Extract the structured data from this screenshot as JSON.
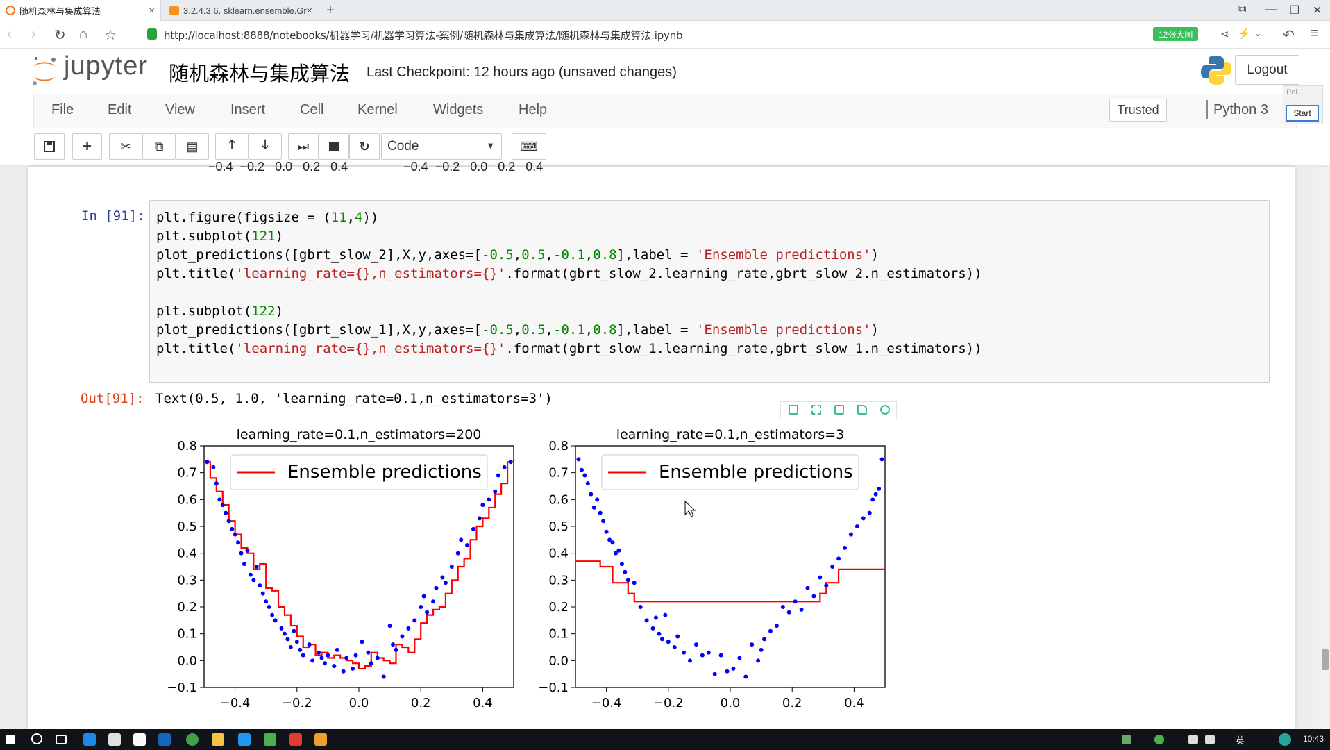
{
  "browser": {
    "tabs": [
      {
        "title": "随机森林与集成算法",
        "active": true
      },
      {
        "title": "3.2.4.3.6. sklearn.ensemble.Gr",
        "active": false
      }
    ],
    "url": "http://localhost:8888/notebooks/机器学习/机器学习算法-案例/随机森林与集成算法/随机森林与集成算法.ipynb",
    "badge": "12张大图"
  },
  "jupyter": {
    "logo_text": "jupyter",
    "notebook_title": "随机森林与集成算法",
    "checkpoint": "Last Checkpoint: 12 hours ago (unsaved changes)",
    "logout_label": "Logout",
    "menu": [
      "File",
      "Edit",
      "View",
      "Insert",
      "Cell",
      "Kernel",
      "Widgets",
      "Help"
    ],
    "trusted_label": "Trusted",
    "kernel_label": "Python 3",
    "popup_label": "Poi...",
    "start_label": "Start",
    "cell_type": "Code"
  },
  "cell": {
    "in_prompt": "In [91]:",
    "out_prompt": "Out[91]:",
    "output_text": "Text(0.5, 1.0, 'learning_rate=0.1,n_estimators=3')",
    "code": [
      "plt.figure(figsize = (11,4))",
      "plt.subplot(121)",
      "plot_predictions([gbrt_slow_2],X,y,axes=[-0.5,0.5,-0.1,0.8],label = 'Ensemble predictions')",
      "plt.title('learning_rate={},n_estimators={}'.format(gbrt_slow_2.learning_rate,gbrt_slow_2.n_estimators))",
      "",
      "plt.subplot(122)",
      "plot_predictions([gbrt_slow_1],X,y,axes=[-0.5,0.5,-0.1,0.8],label = 'Ensemble predictions')",
      "plt.title('learning_rate={},n_estimators={}'.format(gbrt_slow_1.learning_rate,gbrt_slow_1.n_estimators))"
    ]
  },
  "top_axis_remnant": "−0.4  −0.2   0.0   0.2   0.4                −0.4  −0.2   0.0   0.2   0.4",
  "taskbar": {
    "clock": "10:43",
    "lang": "英"
  },
  "colors": {
    "series_line": "#ff0000",
    "series_points": "#0000ff",
    "jupyter_orange": "#f37726"
  },
  "chart_data": [
    {
      "type": "scatter",
      "title": "learning_rate=0.1,n_estimators=200",
      "xlim": [
        -0.5,
        0.5
      ],
      "ylim": [
        -0.1,
        0.8
      ],
      "xticks": [
        "−0.4",
        "−0.2",
        "0.0",
        "0.2",
        "0.4"
      ],
      "yticks": [
        "−0.1",
        "0.0",
        "0.1",
        "0.2",
        "0.3",
        "0.4",
        "0.5",
        "0.6",
        "0.7",
        "0.8"
      ],
      "legend": {
        "label": "Ensemble predictions",
        "position": "upper center"
      },
      "series": [
        {
          "name": "Ensemble predictions",
          "kind": "step-line",
          "x": [
            -0.5,
            -0.48,
            -0.46,
            -0.44,
            -0.42,
            -0.4,
            -0.38,
            -0.36,
            -0.34,
            -0.32,
            -0.3,
            -0.28,
            -0.26,
            -0.24,
            -0.22,
            -0.2,
            -0.18,
            -0.16,
            -0.14,
            -0.12,
            -0.1,
            -0.08,
            -0.06,
            -0.04,
            -0.02,
            0.0,
            0.02,
            0.04,
            0.06,
            0.08,
            0.1,
            0.12,
            0.14,
            0.16,
            0.18,
            0.2,
            0.22,
            0.24,
            0.26,
            0.28,
            0.3,
            0.32,
            0.34,
            0.36,
            0.38,
            0.4,
            0.42,
            0.44,
            0.46,
            0.48,
            0.5
          ],
          "y": [
            0.74,
            0.68,
            0.63,
            0.58,
            0.52,
            0.47,
            0.42,
            0.4,
            0.34,
            0.36,
            0.27,
            0.26,
            0.2,
            0.17,
            0.13,
            0.09,
            0.05,
            0.06,
            0.02,
            0.03,
            0.01,
            0.02,
            0.01,
            0.0,
            -0.01,
            -0.03,
            -0.02,
            0.03,
            0.01,
            0.0,
            -0.01,
            0.06,
            0.05,
            0.03,
            0.08,
            0.14,
            0.17,
            0.19,
            0.2,
            0.25,
            0.3,
            0.35,
            0.38,
            0.45,
            0.5,
            0.53,
            0.57,
            0.62,
            0.66,
            0.74,
            0.75
          ]
        },
        {
          "name": "",
          "kind": "points",
          "x": [
            -0.49,
            -0.47,
            -0.46,
            -0.45,
            -0.44,
            -0.43,
            -0.42,
            -0.41,
            -0.4,
            -0.39,
            -0.38,
            -0.37,
            -0.36,
            -0.35,
            -0.34,
            -0.33,
            -0.32,
            -0.31,
            -0.3,
            -0.29,
            -0.28,
            -0.27,
            -0.25,
            -0.24,
            -0.23,
            -0.22,
            -0.21,
            -0.2,
            -0.19,
            -0.18,
            -0.16,
            -0.15,
            -0.13,
            -0.12,
            -0.11,
            -0.1,
            -0.08,
            -0.07,
            -0.05,
            -0.04,
            -0.02,
            -0.01,
            0.01,
            0.03,
            0.04,
            0.06,
            0.08,
            0.1,
            0.11,
            0.12,
            0.14,
            0.16,
            0.18,
            0.2,
            0.21,
            0.22,
            0.24,
            0.25,
            0.27,
            0.28,
            0.3,
            0.32,
            0.33,
            0.35,
            0.37,
            0.39,
            0.4,
            0.42,
            0.44,
            0.45,
            0.47,
            0.49
          ],
          "y": [
            0.74,
            0.72,
            0.66,
            0.6,
            0.58,
            0.55,
            0.52,
            0.49,
            0.47,
            0.44,
            0.4,
            0.36,
            0.41,
            0.32,
            0.3,
            0.35,
            0.28,
            0.25,
            0.22,
            0.2,
            0.17,
            0.15,
            0.12,
            0.1,
            0.08,
            0.05,
            0.11,
            0.07,
            0.04,
            0.02,
            0.06,
            0.0,
            0.03,
            0.01,
            -0.01,
            0.02,
            -0.02,
            0.04,
            -0.04,
            0.01,
            -0.03,
            0.02,
            0.07,
            0.03,
            -0.01,
            0.01,
            -0.06,
            0.13,
            0.06,
            0.04,
            0.09,
            0.12,
            0.15,
            0.2,
            0.24,
            0.18,
            0.22,
            0.27,
            0.31,
            0.29,
            0.35,
            0.4,
            0.45,
            0.43,
            0.49,
            0.53,
            0.58,
            0.6,
            0.63,
            0.69,
            0.72,
            0.74
          ]
        }
      ]
    },
    {
      "type": "scatter",
      "title": "learning_rate=0.1,n_estimators=3",
      "xlim": [
        -0.5,
        0.5
      ],
      "ylim": [
        -0.1,
        0.8
      ],
      "xticks": [
        "−0.4",
        "−0.2",
        "0.0",
        "0.2",
        "0.4"
      ],
      "yticks": [
        "−0.1",
        "0.0",
        "0.1",
        "0.2",
        "0.3",
        "0.4",
        "0.5",
        "0.6",
        "0.7",
        "0.8"
      ],
      "legend": {
        "label": "Ensemble predictions",
        "position": "upper center"
      },
      "series": [
        {
          "name": "Ensemble predictions",
          "kind": "step-line",
          "x": [
            -0.5,
            -0.42,
            -0.42,
            -0.38,
            -0.38,
            -0.33,
            -0.33,
            -0.31,
            -0.31,
            0.29,
            0.29,
            0.31,
            0.31,
            0.35,
            0.35,
            0.5
          ],
          "y": [
            0.37,
            0.37,
            0.35,
            0.35,
            0.29,
            0.29,
            0.25,
            0.25,
            0.22,
            0.22,
            0.25,
            0.25,
            0.29,
            0.29,
            0.34,
            0.34
          ]
        },
        {
          "name": "",
          "kind": "points",
          "x": [
            -0.49,
            -0.48,
            -0.47,
            -0.46,
            -0.45,
            -0.44,
            -0.43,
            -0.42,
            -0.41,
            -0.4,
            -0.39,
            -0.38,
            -0.37,
            -0.36,
            -0.35,
            -0.34,
            -0.33,
            -0.31,
            -0.29,
            -0.27,
            -0.25,
            -0.24,
            -0.23,
            -0.22,
            -0.21,
            -0.2,
            -0.18,
            -0.17,
            -0.15,
            -0.13,
            -0.11,
            -0.09,
            -0.07,
            -0.05,
            -0.03,
            -0.01,
            0.01,
            0.03,
            0.05,
            0.07,
            0.09,
            0.1,
            0.11,
            0.13,
            0.15,
            0.17,
            0.19,
            0.21,
            0.23,
            0.25,
            0.27,
            0.29,
            0.31,
            0.33,
            0.35,
            0.37,
            0.39,
            0.41,
            0.43,
            0.45,
            0.46,
            0.47,
            0.48,
            0.49
          ],
          "y": [
            0.75,
            0.71,
            0.69,
            0.66,
            0.62,
            0.57,
            0.6,
            0.55,
            0.52,
            0.48,
            0.45,
            0.44,
            0.4,
            0.41,
            0.36,
            0.33,
            0.3,
            0.29,
            0.2,
            0.15,
            0.12,
            0.16,
            0.1,
            0.08,
            0.17,
            0.07,
            0.05,
            0.09,
            0.03,
            0.0,
            0.06,
            0.02,
            0.03,
            -0.05,
            0.02,
            -0.04,
            -0.03,
            0.01,
            -0.06,
            0.06,
            0.0,
            0.04,
            0.08,
            0.11,
            0.13,
            0.2,
            0.18,
            0.22,
            0.19,
            0.27,
            0.24,
            0.31,
            0.28,
            0.35,
            0.38,
            0.42,
            0.47,
            0.5,
            0.53,
            0.55,
            0.6,
            0.62,
            0.64,
            0.75
          ]
        }
      ]
    }
  ]
}
